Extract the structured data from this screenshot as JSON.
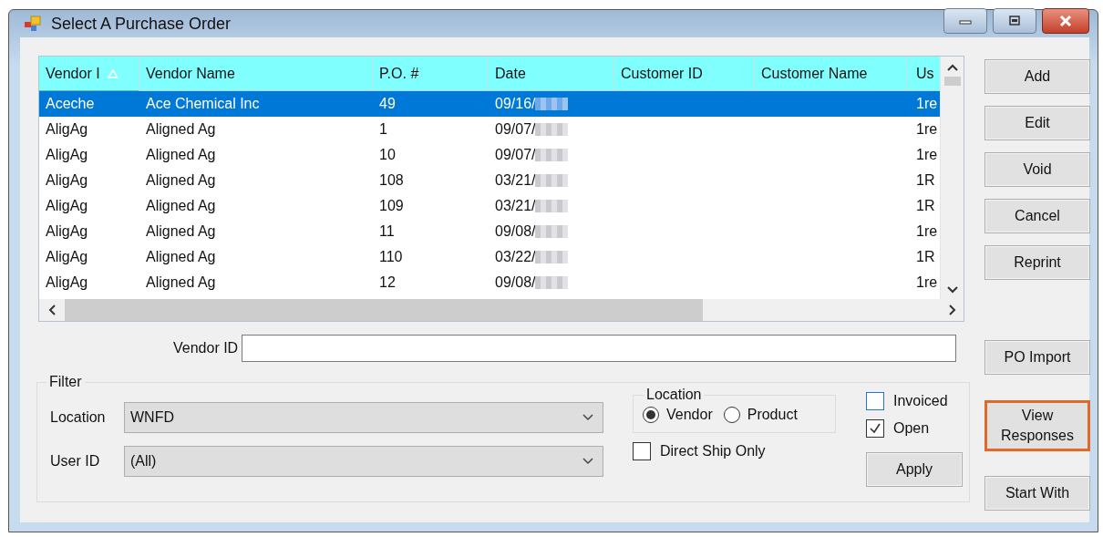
{
  "window": {
    "title": "Select A Purchase Order"
  },
  "table": {
    "columns": [
      {
        "label": "Vendor I",
        "sorted": true
      },
      {
        "label": "Vendor Name",
        "sorted": false
      },
      {
        "label": "P.O. #",
        "sorted": false
      },
      {
        "label": "Date",
        "sorted": false
      },
      {
        "label": "Customer ID",
        "sorted": false
      },
      {
        "label": "Customer Name",
        "sorted": false
      },
      {
        "label": "Us",
        "sorted": false
      }
    ],
    "dates_redacted": true,
    "rows": [
      {
        "selected": true,
        "vendor_id": "Aceche",
        "vendor_name": "Ace Chemical Inc",
        "po_number": "49",
        "date": "09/16/",
        "column_7": "1re"
      },
      {
        "selected": false,
        "vendor_id": "AligAg",
        "vendor_name": "Aligned Ag",
        "po_number": "1",
        "date": "09/07/",
        "column_7": "1re"
      },
      {
        "selected": false,
        "vendor_id": "AligAg",
        "vendor_name": "Aligned Ag",
        "po_number": "10",
        "date": "09/07/",
        "column_7": "1re"
      },
      {
        "selected": false,
        "vendor_id": "AligAg",
        "vendor_name": "Aligned Ag",
        "po_number": "108",
        "date": "03/21/",
        "column_7": "1R"
      },
      {
        "selected": false,
        "vendor_id": "AligAg",
        "vendor_name": "Aligned Ag",
        "po_number": "109",
        "date": "03/21/",
        "column_7": "1R"
      },
      {
        "selected": false,
        "vendor_id": "AligAg",
        "vendor_name": "Aligned Ag",
        "po_number": "11",
        "date": "09/08/",
        "column_7": "1re"
      },
      {
        "selected": false,
        "vendor_id": "AligAg",
        "vendor_name": "Aligned Ag",
        "po_number": "110",
        "date": "03/22/",
        "column_7": "1R"
      },
      {
        "selected": false,
        "vendor_id": "AligAg",
        "vendor_name": "Aligned Ag",
        "po_number": "12",
        "date": "09/08/",
        "column_7": "1re"
      }
    ]
  },
  "side_buttons": [
    {
      "label": "Add",
      "highlighted": false
    },
    {
      "label": "Edit",
      "highlighted": false
    },
    {
      "label": "Void",
      "highlighted": false
    },
    {
      "label": "Cancel",
      "highlighted": false
    },
    {
      "label": "Reprint",
      "highlighted": false
    },
    {
      "label": "PO Import",
      "highlighted": false
    },
    {
      "label": "View Responses",
      "highlighted": true
    },
    {
      "label": "Start With",
      "highlighted": false
    }
  ],
  "vendor_id_field": {
    "label": "Vendor ID"
  },
  "filter": {
    "title": "Filter",
    "location": {
      "label": "Location",
      "value": "WNFD"
    },
    "user_id": {
      "label": "User ID",
      "value": "(All)"
    },
    "location_mode": {
      "title": "Location",
      "options": [
        {
          "label": "Vendor",
          "selected": true
        },
        {
          "label": "Product",
          "selected": false
        }
      ]
    },
    "direct_ship_only": {
      "label": "Direct Ship Only",
      "checked": false,
      "focused": false
    },
    "invoiced": {
      "label": "Invoiced",
      "checked": false,
      "focused": true
    },
    "open": {
      "label": "Open",
      "checked": true,
      "focused": false
    },
    "apply_button": "Apply"
  }
}
